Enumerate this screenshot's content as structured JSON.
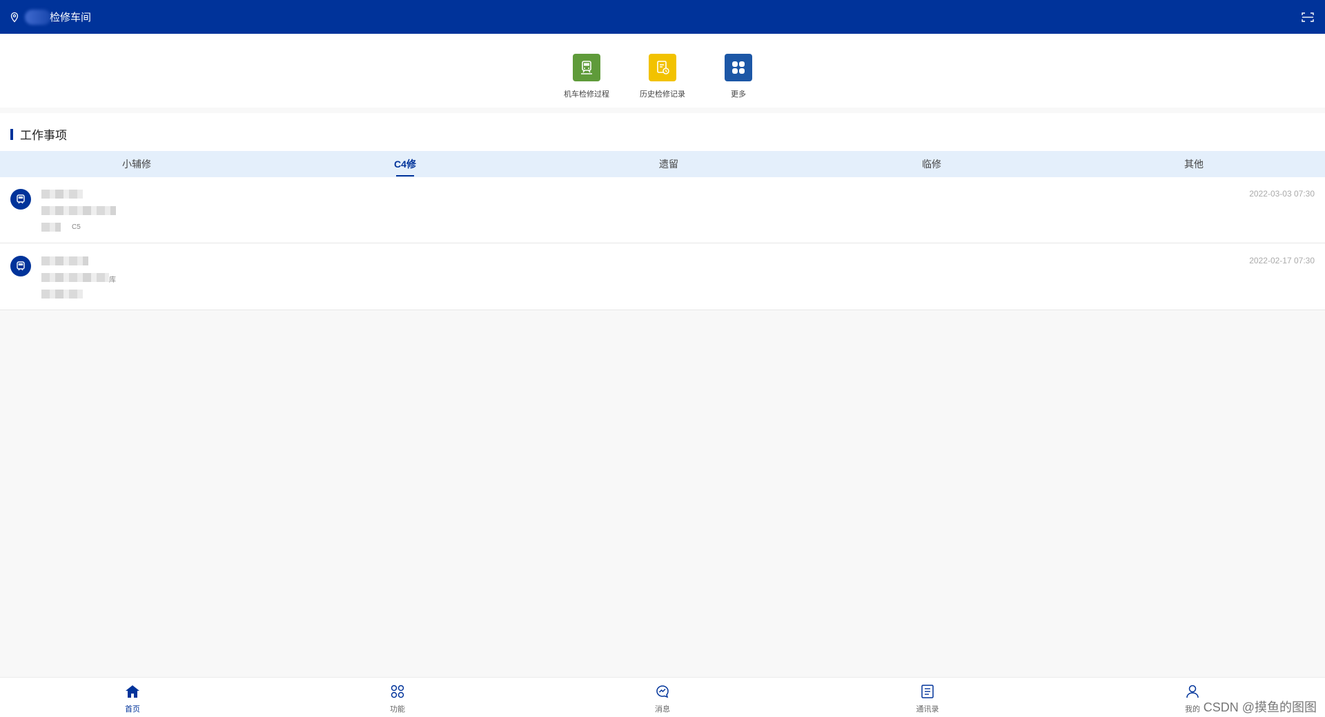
{
  "header": {
    "title": "检修车间",
    "location_icon": "location-pin-icon",
    "scan_icon": "scan-icon"
  },
  "quick_actions": [
    {
      "label": "机车检修过程",
      "icon": "train-icon",
      "color": "#5f9b3a"
    },
    {
      "label": "历史检修记录",
      "icon": "record-icon",
      "color": "#f2c200"
    },
    {
      "label": "更多",
      "icon": "grid-icon",
      "color": "#1c57a6"
    }
  ],
  "work": {
    "title": "工作事项",
    "tabs": [
      {
        "label": "小辅修",
        "active": false
      },
      {
        "label": "C4修",
        "active": true
      },
      {
        "label": "遗留",
        "active": false
      },
      {
        "label": "临修",
        "active": false
      },
      {
        "label": "其他",
        "active": false
      }
    ],
    "items": [
      {
        "time": "2022-03-03 07:30",
        "suffix": "C5"
      },
      {
        "time": "2022-02-17 07:30",
        "suffix": "库"
      }
    ]
  },
  "bottom_nav": [
    {
      "label": "首页",
      "icon": "home-icon",
      "active": true
    },
    {
      "label": "功能",
      "icon": "apps-icon",
      "active": false
    },
    {
      "label": "消息",
      "icon": "message-icon",
      "active": false
    },
    {
      "label": "通讯录",
      "icon": "contacts-icon",
      "active": false
    },
    {
      "label": "我的",
      "icon": "user-icon",
      "active": false
    }
  ],
  "watermark": "CSDN @摸鱼的图图",
  "colors": {
    "primary": "#00339a",
    "tab_bg": "#e4effb",
    "page_bg": "#f8f8f8"
  }
}
